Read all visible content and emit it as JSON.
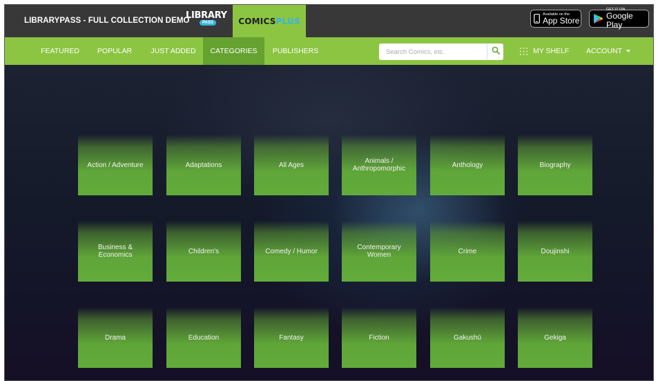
{
  "header": {
    "site_title": "LIBRARYPASS - FULL COLLECTION DEMO",
    "logo_library": "LIBRARY",
    "logo_pass": "PASS",
    "logo_comics": "COMICS",
    "logo_plus": "PLUS",
    "app_store": {
      "small": "Available on the",
      "big": "App Store"
    },
    "google_play": {
      "small": "GET IT ON",
      "big": "Google Play"
    }
  },
  "nav": {
    "items": [
      "FEATURED",
      "POPULAR",
      "JUST ADDED",
      "CATEGORIES",
      "PUBLISHERS"
    ],
    "active": "CATEGORIES",
    "search_placeholder": "Search Comics, etc.",
    "my_shelf": "MY SHELF",
    "account": "ACCOUNT"
  },
  "categories": [
    "Action / Adventure",
    "Adaptations",
    "All Ages",
    "Animals / Anthropomorphic",
    "Anthology",
    "Biography",
    "Business & Economics",
    "Children's",
    "Comedy / Humor",
    "Contemporary Women",
    "Crime",
    "Doujinshi",
    "Drama",
    "Education",
    "Fantasy",
    "Fiction",
    "Gakushū",
    "Gekiga"
  ],
  "colors": {
    "topbar": "#383838",
    "brand_green": "#8cc542",
    "active_green": "#65a230",
    "accent_blue": "#35b6e0"
  }
}
